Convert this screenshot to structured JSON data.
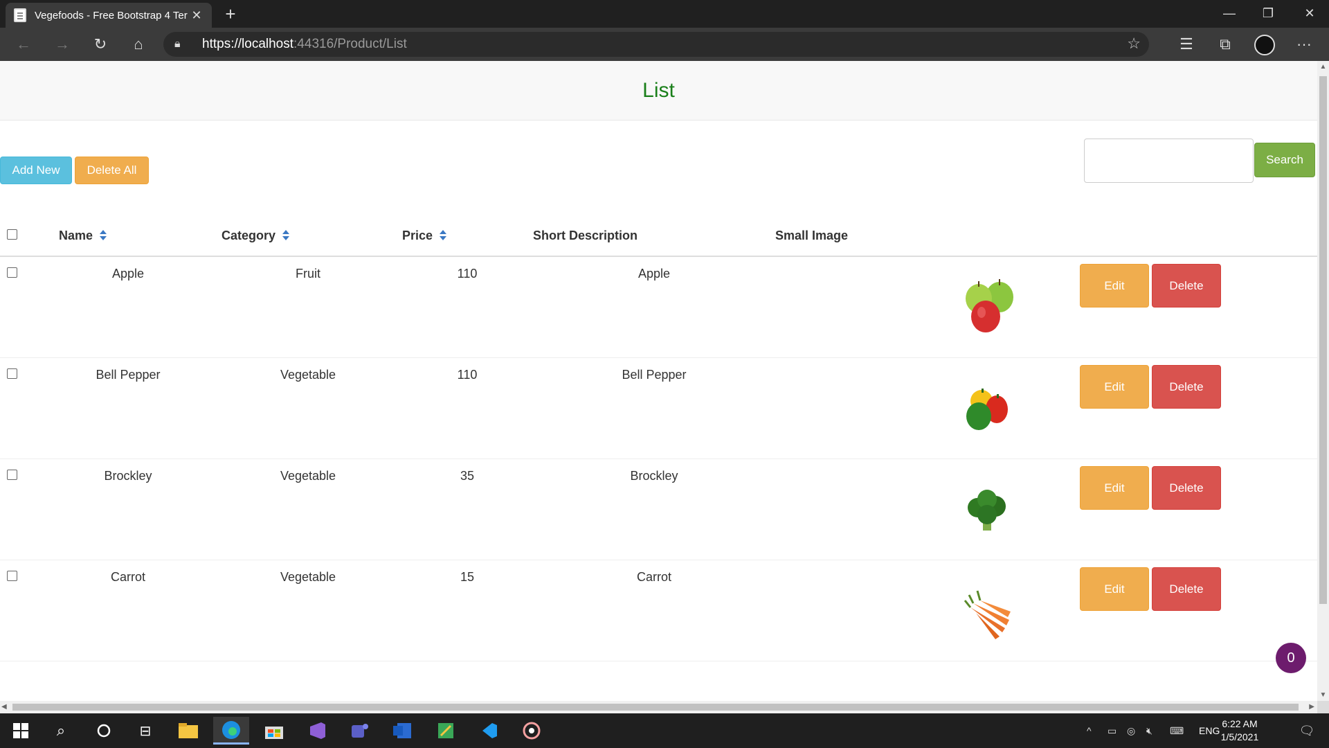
{
  "browser": {
    "tab_title": "Vegefoods - Free Bootstrap 4 Ter",
    "url_scheme": "https://",
    "url_host": "localhost",
    "url_rest": ":44316/Product/List"
  },
  "page": {
    "title": "List",
    "add_new_label": "Add New",
    "delete_all_label": "Delete All",
    "search_label": "Search",
    "search_value": "",
    "columns": {
      "name": "Name",
      "category": "Category",
      "price": "Price",
      "short_description": "Short Description",
      "small_image": "Small Image"
    },
    "edit_label": "Edit",
    "delete_label": "Delete",
    "products": [
      {
        "name": "Apple",
        "category": "Fruit",
        "price": "110",
        "short_description": "Apple",
        "image": "apple-image"
      },
      {
        "name": "Bell Pepper",
        "category": "Vegetable",
        "price": "110",
        "short_description": "Bell Pepper",
        "image": "bell-pepper-image"
      },
      {
        "name": "Brockley",
        "category": "Vegetable",
        "price": "35",
        "short_description": "Brockley",
        "image": "broccoli-image"
      },
      {
        "name": "Carrot",
        "category": "Vegetable",
        "price": "15",
        "short_description": "Carrot",
        "image": "carrot-image"
      }
    ],
    "cart_count": "0"
  },
  "taskbar": {
    "language": "ENG",
    "time": "6:22 AM",
    "date": "1/5/2021"
  },
  "colors": {
    "title_green": "#1a7f1a",
    "info": "#5bc0de",
    "warning": "#f0ad4e",
    "danger": "#d9534f",
    "success": "#7cae45",
    "cart_badge": "#6d1c6d"
  }
}
